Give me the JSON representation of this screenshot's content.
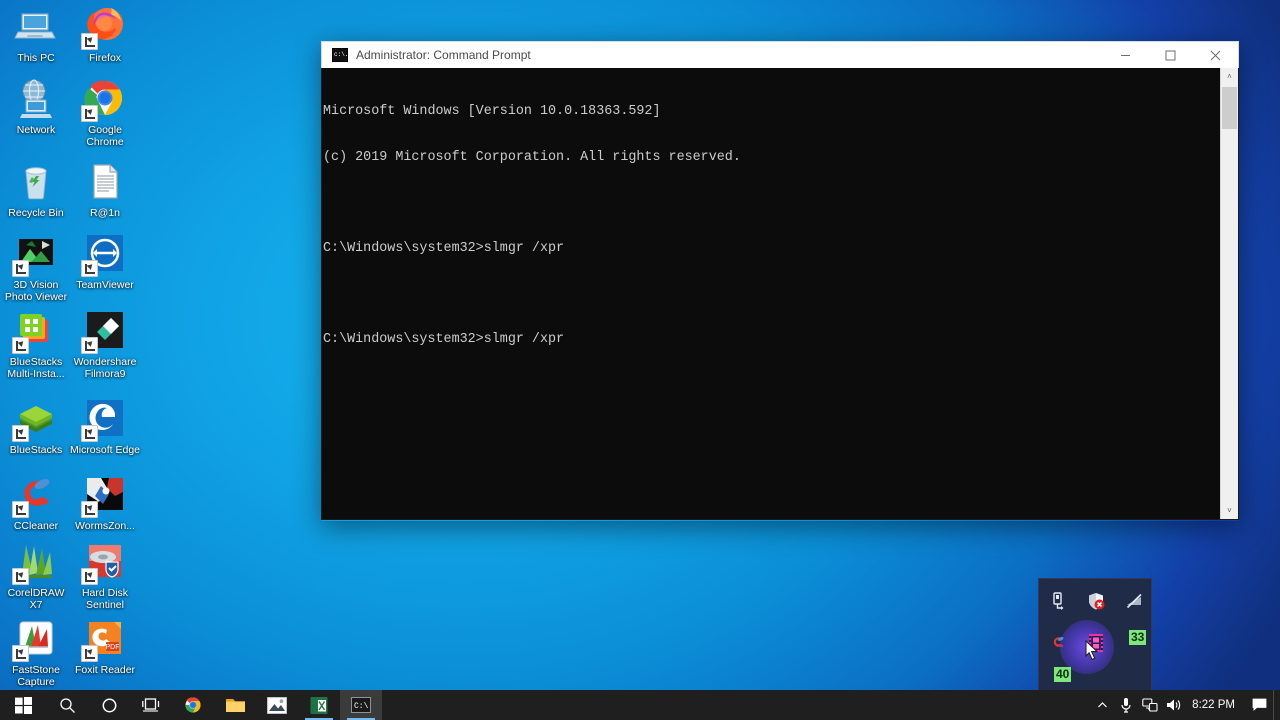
{
  "desktop": {
    "background_color": "#10a2e4",
    "icons": [
      {
        "label": "This PC",
        "icon": "computer-icon",
        "shortcut": false
      },
      {
        "label": "Firefox",
        "icon": "firefox-icon",
        "shortcut": true
      },
      {
        "label": "Network",
        "icon": "network-icon",
        "shortcut": false
      },
      {
        "label": "Google Chrome",
        "icon": "chrome-icon",
        "shortcut": true
      },
      {
        "label": "Recycle Bin",
        "icon": "recycle-bin-icon",
        "shortcut": false
      },
      {
        "label": "R@1n",
        "icon": "text-document-icon",
        "shortcut": false
      },
      {
        "label": "3D Vision Photo Viewer",
        "icon": "3d-vision-photo-viewer-icon",
        "shortcut": true
      },
      {
        "label": "TeamViewer",
        "icon": "teamviewer-icon",
        "shortcut": true
      },
      {
        "label": "BlueStacks Multi-Insta...",
        "icon": "bluestacks-multi-instance-icon",
        "shortcut": true
      },
      {
        "label": "Wondershare Filmora9",
        "icon": "wondershare-filmora9-icon",
        "shortcut": true
      },
      {
        "label": "BlueStacks",
        "icon": "bluestacks-icon",
        "shortcut": true
      },
      {
        "label": "Microsoft Edge",
        "icon": "microsoft-edge-icon",
        "shortcut": true
      },
      {
        "label": "CCleaner",
        "icon": "ccleaner-icon",
        "shortcut": true
      },
      {
        "label": "WormsZon...",
        "icon": "wormszone-icon",
        "shortcut": true
      },
      {
        "label": "CorelDRAW X7",
        "icon": "coreldraw-x7-icon",
        "shortcut": true
      },
      {
        "label": "Hard Disk Sentinel",
        "icon": "hard-disk-sentinel-icon",
        "shortcut": true
      },
      {
        "label": "FastStone Capture",
        "icon": "faststone-capture-icon",
        "shortcut": true
      },
      {
        "label": "Foxit Reader",
        "icon": "foxit-reader-icon",
        "shortcut": true
      }
    ]
  },
  "cmd_window": {
    "title": "Administrator: Command Prompt",
    "title_icon": "console-icon",
    "minimize_label": "–",
    "maximize_label": "☐",
    "close_label": "✕",
    "background_color": "#0c0c0c",
    "text_color": "#cccccc",
    "lines": [
      "Microsoft Windows [Version 10.0.18363.592]",
      "(c) 2019 Microsoft Corporation. All rights reserved.",
      "",
      "C:\\Windows\\system32>slmgr /xpr",
      "",
      "C:\\Windows\\system32>slmgr /xpr"
    ],
    "scrollbar": {
      "up_arrow": "˄",
      "down_arrow": "˅"
    }
  },
  "tray_panel": {
    "background_color": "#1f2b47",
    "row1": [
      {
        "icon": "safely-remove-hardware-icon"
      },
      {
        "icon": "security-shield-alert-icon"
      },
      {
        "icon": "network-disconnected-icon"
      }
    ],
    "row2": [
      {
        "icon": "ccleaner-tray-icon"
      },
      {
        "icon": "filmora-tray-icon"
      }
    ],
    "badges": [
      {
        "value": "33",
        "color": "#7ce87c"
      },
      {
        "value": "40",
        "color": "#7ce87c"
      }
    ]
  },
  "taskbar": {
    "background_color": "#1f1f1f",
    "start": {
      "icon": "windows-start-icon"
    },
    "items": [
      {
        "icon": "search-icon",
        "label": "Search",
        "running": false
      },
      {
        "icon": "cortana-icon",
        "label": "Cortana",
        "running": false
      },
      {
        "icon": "task-view-icon",
        "label": "Task View",
        "running": false
      },
      {
        "icon": "chrome-icon",
        "label": "Google Chrome",
        "running": false
      },
      {
        "icon": "file-explorer-icon",
        "label": "File Explorer",
        "running": false
      },
      {
        "icon": "photos-icon",
        "label": "Photos",
        "running": false
      },
      {
        "icon": "excel-icon",
        "label": "Excel",
        "running": true
      },
      {
        "icon": "command-prompt-icon",
        "label": "Command Prompt",
        "running": true
      }
    ],
    "tray": [
      {
        "icon": "chevron-up-icon",
        "label": "Show hidden icons"
      },
      {
        "icon": "microphone-icon",
        "label": "Microphone"
      },
      {
        "icon": "network-icon",
        "label": "Network"
      },
      {
        "icon": "volume-icon",
        "label": "Volume"
      }
    ],
    "clock": "8:22 PM",
    "action_center": {
      "icon": "action-center-icon",
      "label": "Notifications"
    }
  }
}
